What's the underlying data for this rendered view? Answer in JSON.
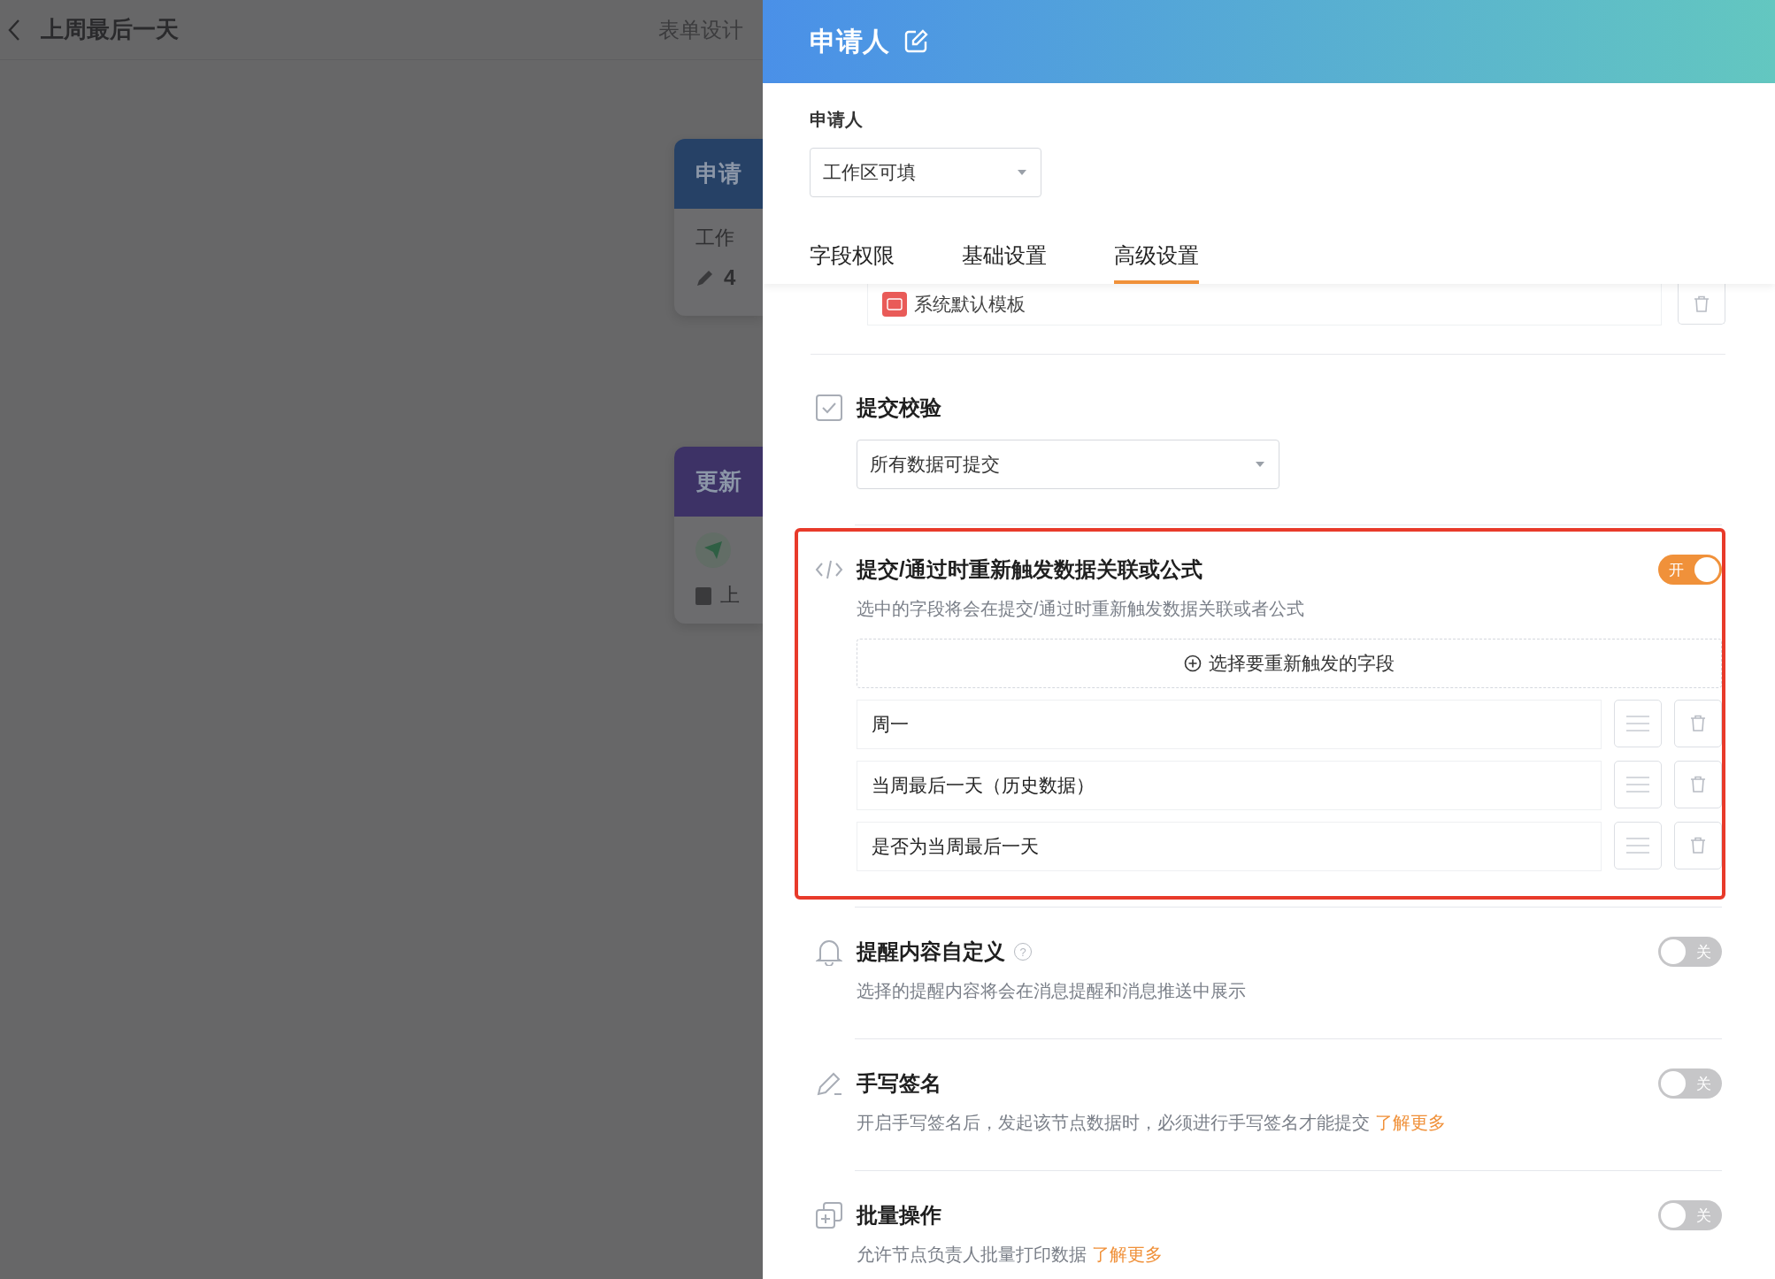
{
  "background": {
    "header": {
      "title": "上周最后一天",
      "action": "表单设计"
    },
    "nodes": [
      {
        "kind": "applicant",
        "title": "申请",
        "color": "#264166",
        "line": "工作",
        "count": "4"
      },
      {
        "kind": "update",
        "title": "更新",
        "color": "#3d3266",
        "line": "上"
      }
    ]
  },
  "panel": {
    "title": "申请人",
    "field_label": "申请人",
    "permission_select": {
      "value": "工作区可填"
    },
    "tabs": [
      {
        "label": "字段权限",
        "selected": false
      },
      {
        "label": "基础设置",
        "selected": false
      },
      {
        "label": "高级设置",
        "selected": true
      }
    ],
    "template": {
      "name": "系统默认模板"
    },
    "sections": [
      {
        "kind": "validation",
        "title": "提交校验",
        "highlighted": false,
        "select": {
          "value": "所有数据可提交"
        }
      },
      {
        "kind": "retrigger",
        "title": "提交/通过时重新触发数据关联或公式",
        "highlighted": true,
        "on": true,
        "toggle_label": "开",
        "description": "选中的字段将会在提交/通过时重新触发数据关联或者公式",
        "add_button": "选择要重新触发的字段",
        "fields": [
          "周一",
          "当周最后一天（历史数据）",
          "是否为当周最后一天"
        ]
      },
      {
        "kind": "reminder",
        "title": "提醒内容自定义",
        "help": "?",
        "highlighted": false,
        "on": false,
        "toggle_label": "关",
        "description": "选择的提醒内容将会在消息提醒和消息推送中展示"
      },
      {
        "kind": "signature",
        "title": "手写签名",
        "highlighted": false,
        "on": false,
        "toggle_label": "关",
        "description": "开启手写签名后，发起该节点数据时，必须进行手写签名才能提交",
        "link": "了解更多"
      },
      {
        "kind": "batch",
        "title": "批量操作",
        "highlighted": false,
        "on": false,
        "toggle_label": "关",
        "description": "允许节点负责人批量打印数据",
        "link": "了解更多"
      }
    ]
  }
}
